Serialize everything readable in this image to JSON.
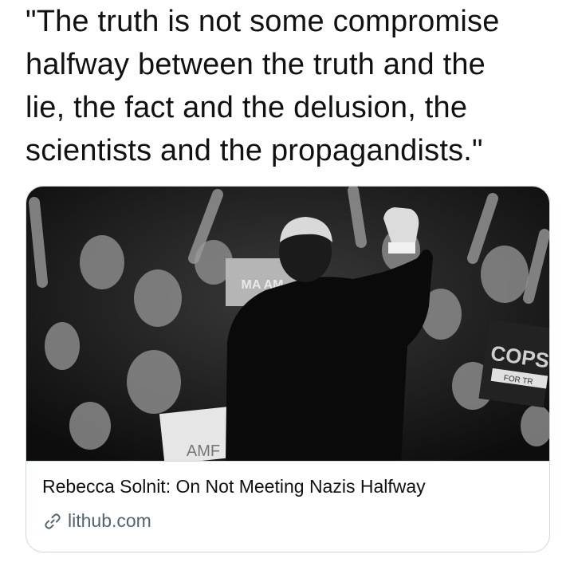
{
  "tweet": {
    "lines": [
      "\"The truth is not some compromise",
      "halfway between the truth and the",
      "lie, the fact and the delusion, the",
      "scientists and the propagandists.\""
    ]
  },
  "card": {
    "image_icon": "rally-photo",
    "sign_left": "MA AM",
    "sign_right": [
      "COPS",
      "FOR TR"
    ],
    "sign_bottom": "AMF",
    "title": "Rebecca Solnit: On Not Meeting Nazis Halfway",
    "domain": "lithub.com",
    "domain_icon": "link-icon"
  },
  "colors": {
    "text": "#111111",
    "secondary": "#536471",
    "border": "#cfd9de"
  }
}
